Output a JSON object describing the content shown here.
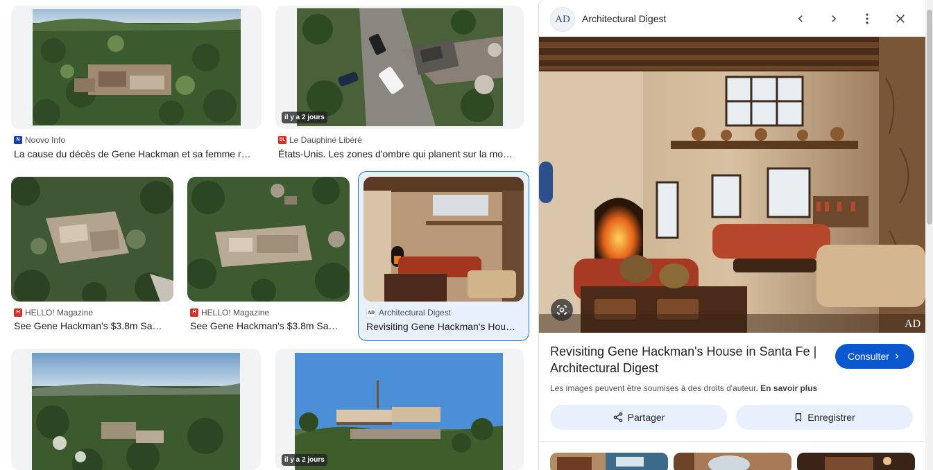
{
  "results": [
    {
      "source": "Noovo Info",
      "title": "La cause du décès de Gene Hackman et sa femme r…",
      "favicon_color": "#1a3fae",
      "favicon_text": "N"
    },
    {
      "source": "Le Dauphiné Libéré",
      "title": "États-Unis. Les zones d'ombre qui planent sur la mo…",
      "favicon_color": "#d93025",
      "favicon_text": "DL",
      "badge": "il y a 2 jours"
    },
    {
      "source": "HELLO! Magazine",
      "title": "See Gene Hackman's $3.8m Sa…",
      "favicon_color": "#d93025",
      "favicon_text": "H"
    },
    {
      "source": "HELLO! Magazine",
      "title": "See Gene Hackman's $3.8m Sa…",
      "favicon_color": "#d93025",
      "favicon_text": "H"
    },
    {
      "source": "Architectural Digest",
      "title": "Revisiting Gene Hackman's Hou…",
      "favicon_color": "#ffffff",
      "favicon_text": "AD"
    },
    {
      "source": "",
      "title": ""
    },
    {
      "source": "",
      "title": "",
      "badge": "il y a 2 jours"
    }
  ],
  "panel": {
    "logo": "AD",
    "site_name": "Architectural Digest",
    "watermark": "AD",
    "title_line1": "Revisiting Gene Hackman's House in Santa Fe |",
    "title_line2": "Architectural Digest",
    "visit_label": "Consulter",
    "copyright_text": "Les images peuvent être soumises à des droits d'auteur.",
    "learn_more": "En savoir plus",
    "share_label": "Partager",
    "save_label": "Enregistrer"
  },
  "icons": {
    "prev": "chevron-left-icon",
    "next": "chevron-right-icon",
    "more": "more-vert-icon",
    "close": "close-icon",
    "lens": "lens-icon",
    "share": "share-icon",
    "bookmark": "bookmark-icon",
    "visit_arrow": "chevron-right-icon"
  },
  "colors": {
    "accent": "#1a73e8",
    "button_blue": "#0b57d0",
    "pill_bg": "#e8f0fe",
    "selected_bg": "#e8f0fe"
  }
}
